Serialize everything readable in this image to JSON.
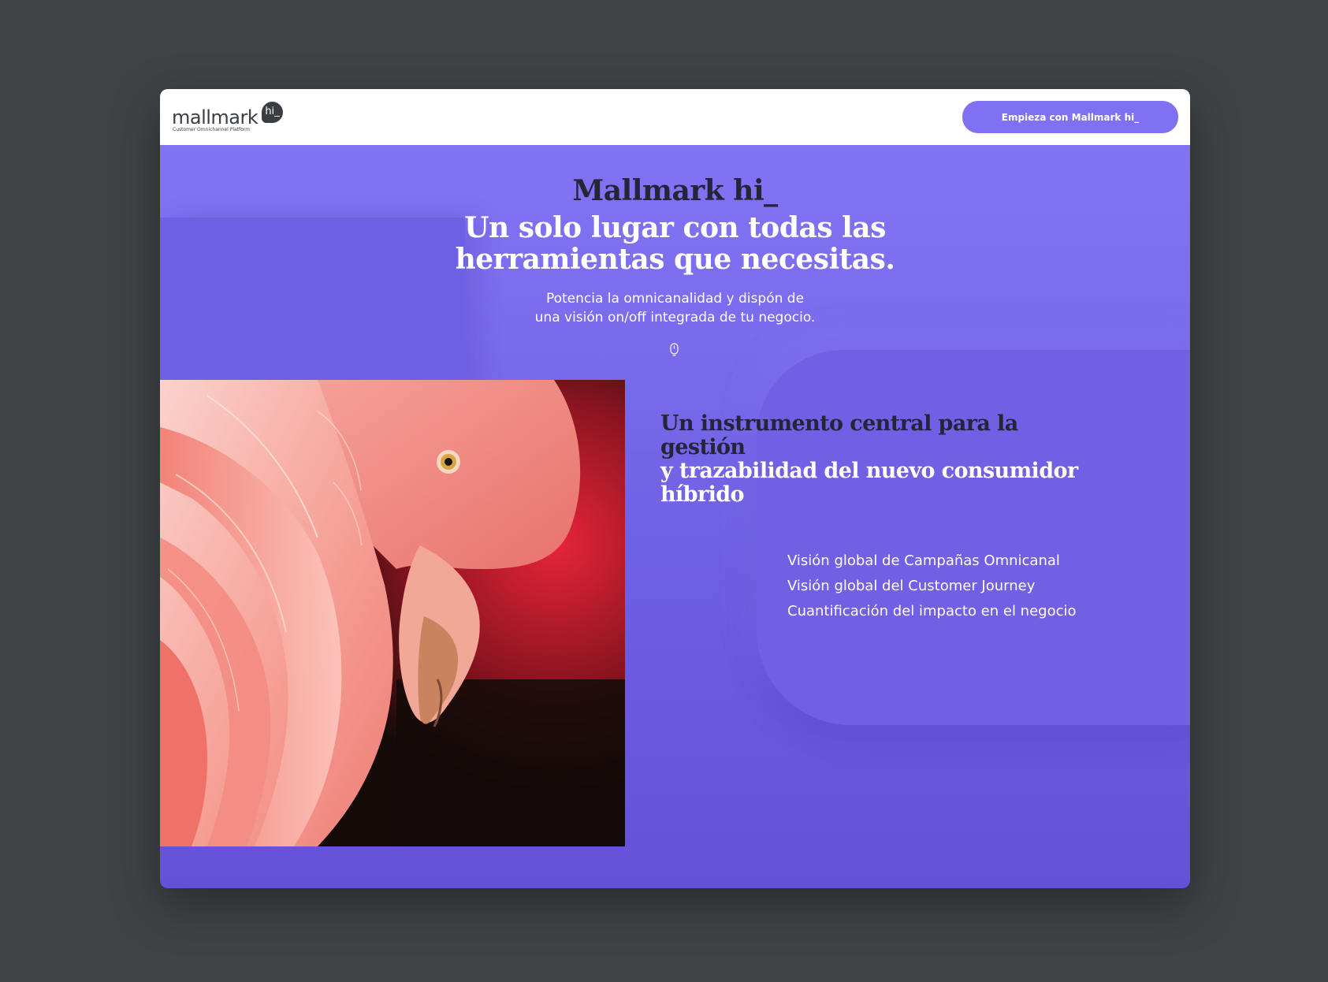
{
  "header": {
    "logo": {
      "wordmark": "mallmark",
      "badge": "hi_",
      "tagline": "Customer Omnichannel Platform"
    },
    "cta_label": "Empieza con Mallmark hi_"
  },
  "hero": {
    "brand": "Mallmark hi_",
    "title_line1": "Un solo lugar con todas las",
    "title_line2": "herramientas que necesitas.",
    "subtitle_line1": "Potencia la omnicanalidad y dispón de",
    "subtitle_line2": "una visión on/off integrada de tu negocio.",
    "scroll_icon": "mouse-scroll-icon"
  },
  "section": {
    "title_line1": "Un instrumento central para la gestión",
    "title_line2": "y trazabilidad del nuevo consumidor",
    "title_line3": "híbrido",
    "features": [
      "Visión global de Campañas Omnicanal",
      "Visión global del Customer Journey",
      "Cuantificación del impacto en el negocio"
    ]
  },
  "image": {
    "subject": "flamingo-photo"
  },
  "colors": {
    "page_background": "#3f4346",
    "accent_purple": "#7f71f2",
    "heading_dark": "#25253a",
    "flamingo_pink": "#f07e78"
  }
}
